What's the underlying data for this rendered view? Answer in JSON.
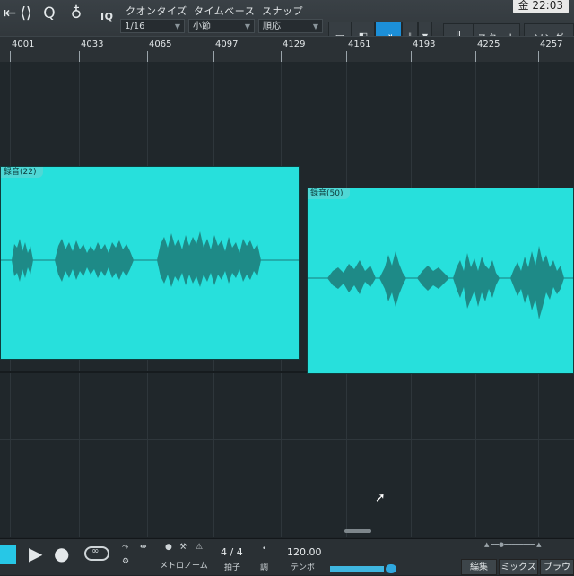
{
  "toolbar": {
    "iq_label": "IQ",
    "quantize_label": "クオンタイズ",
    "timebase_label": "タイムベース",
    "snap_label": "スナップ",
    "quantize_value": "1/16",
    "timebase_value": "小節",
    "snap_value": "順応",
    "start_label": "スタート",
    "song_label": "ソング"
  },
  "clock": {
    "text": "金 22:03"
  },
  "ruler": {
    "bars": [
      "4001",
      "4033",
      "4065",
      "4097",
      "4129",
      "4161",
      "4193",
      "4225",
      "4257"
    ]
  },
  "events": [
    {
      "name": "録音(22)"
    },
    {
      "name": "録音(50)"
    }
  ],
  "transport": {
    "signature": "4 / 4",
    "signature_caption": "拍子",
    "key_caption": "調",
    "tempo": "120.00",
    "tempo_caption": "テンポ",
    "metronome_label": "メトロノーム",
    "edit_tab": "編集",
    "mix_tab": "ミックス",
    "browse_tab": "ブラウ"
  }
}
